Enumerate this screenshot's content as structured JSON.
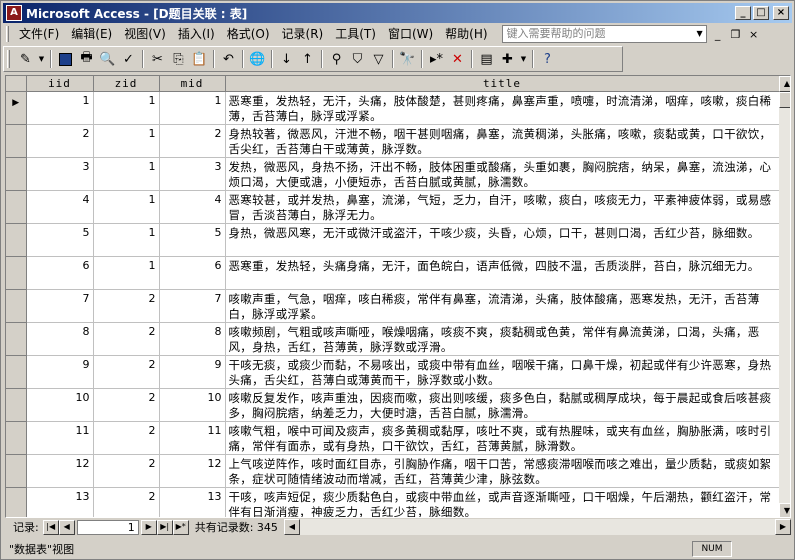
{
  "window": {
    "app_icon": "A",
    "title": "Microsoft Access - [D题目关联 : 表]"
  },
  "menu": {
    "items": [
      "文件(F)",
      "编辑(E)",
      "视图(V)",
      "插入(I)",
      "格式(O)",
      "记录(R)",
      "工具(T)",
      "窗口(W)",
      "帮助(H)"
    ],
    "help_placeholder": "键入需要帮助的问题"
  },
  "toolbar": {
    "icons": [
      "view-design-icon",
      "save-icon",
      "print-icon",
      "print-preview-icon",
      "spelling-icon",
      "cut-icon",
      "copy-icon",
      "paste-icon",
      "undo-icon",
      "hyperlink-icon",
      "sort-ascending-icon",
      "sort-descending-icon",
      "filter-by-selection-icon",
      "filter-by-form-icon",
      "apply-filter-icon",
      "find-icon",
      "new-record-icon",
      "delete-record-icon",
      "database-window-icon",
      "new-object-icon",
      "help-icon"
    ]
  },
  "table": {
    "columns": [
      "iid",
      "zid",
      "mid",
      "title"
    ],
    "rows": [
      {
        "iid": "1",
        "zid": "1",
        "mid": "1",
        "title": "恶寒重，发热轻，无汗，头痛，肢体酸楚，甚则疼痛，鼻塞声重，喷嚏，时流清涕，咽痒，咳嗽，痰白稀薄，舌苔薄白，脉浮或浮紧。"
      },
      {
        "iid": "2",
        "zid": "1",
        "mid": "2",
        "title": "身热较著，微恶风，汗泄不畅，咽干甚则咽痛，鼻塞，流黄稠涕，头胀痛，咳嗽，痰黏或黄，口干欲饮，舌尖红，舌苔薄白干或薄黄，脉浮数。"
      },
      {
        "iid": "3",
        "zid": "1",
        "mid": "3",
        "title": "发热，微恶风，身热不扬，汗出不畅，肢体困重或酸痛，头重如裹，胸闷脘痞，纳呆，鼻塞，流浊涕，心烦口渴，大便或溏，小便短赤，舌苔白腻或黄腻，脉濡数。"
      },
      {
        "iid": "4",
        "zid": "1",
        "mid": "4",
        "title": "恶寒较甚，或并发热，鼻塞，流涕，气短，乏力，自汗，咳嗽，痰白，咳痰无力，平素神疲体弱，或易感冒，舌淡苔薄白，脉浮无力。"
      },
      {
        "iid": "5",
        "zid": "1",
        "mid": "5",
        "title": "身热，微恶风寒，无汗或微汗或盗汗，干咳少痰，头昏，心烦，口干，甚则口渴，舌红少苔，脉细数。"
      },
      {
        "iid": "6",
        "zid": "1",
        "mid": "6",
        "title": "恶寒重，发热轻，头痛身痛，无汗，面色皖白，语声低微，四肢不温，舌质淡胖，苔白，脉沉细无力。"
      },
      {
        "iid": "7",
        "zid": "2",
        "mid": "7",
        "title": "咳嗽声重，气急，咽痒，咳白稀痰，常伴有鼻塞，流清涕，头痛，肢体酸痛，恶寒发热，无汗，舌苔薄白，脉浮或浮紧。"
      },
      {
        "iid": "8",
        "zid": "2",
        "mid": "8",
        "title": "咳嗽频剧，气粗或咳声嘶哑，喉燥咽痛，咳痰不爽，痰黏稠或色黄，常伴有鼻流黄涕，口渴，头痛，恶风，身热，舌红，苔薄黄，脉浮数或浮滑。"
      },
      {
        "iid": "9",
        "zid": "2",
        "mid": "9",
        "title": "干咳无痰，或痰少而黏，不易咳出，或痰中带有血丝，咽喉干痛，口鼻干燥，初起或伴有少许恶寒，身热头痛，舌尖红，苔薄白或薄黄而干，脉浮数或小数。"
      },
      {
        "iid": "10",
        "zid": "2",
        "mid": "10",
        "title": "咳嗽反复发作，咳声重浊，因痰而嗽，痰出则咳缓，痰多色白，黏腻或稠厚成块，每于晨起或食后咳甚痰多，胸闷脘痞，纳差乏力，大便时溏，舌苔白腻，脉濡滑。"
      },
      {
        "iid": "11",
        "zid": "2",
        "mid": "11",
        "title": "咳嗽气粗，喉中可闻及痰声，痰多黄稠或黏厚，咳吐不爽，或有热腥味，或夹有血丝，胸胁胀满，咳时引痛，常伴有面赤，或有身热，口干欲饮，舌红，苔薄黄腻，脉滑数。"
      },
      {
        "iid": "12",
        "zid": "2",
        "mid": "12",
        "title": "上气咳逆阵作，咳时面红目赤，引胸胁作痛，咽干口苦，常感痰滞咽喉而咳之难出，量少质黏，或痰如絮条，症状可随情绪波动而增减，舌红，苔薄黄少津，脉弦数。"
      },
      {
        "iid": "13",
        "zid": "2",
        "mid": "13",
        "title": "干咳，咳声短促，痰少质黏色白，或痰中带血丝，或声音逐渐嘶哑，口干咽燥，午后潮热，颧红盗汗，常伴有日渐消瘦，神疲乏力，舌红少苔，脉细数。"
      }
    ]
  },
  "navigation": {
    "label": "记录:",
    "current": "1",
    "count_text": "共有记录数: 345"
  },
  "status": {
    "view_text": "\"数据表\"视图",
    "indicator": "NUM"
  }
}
